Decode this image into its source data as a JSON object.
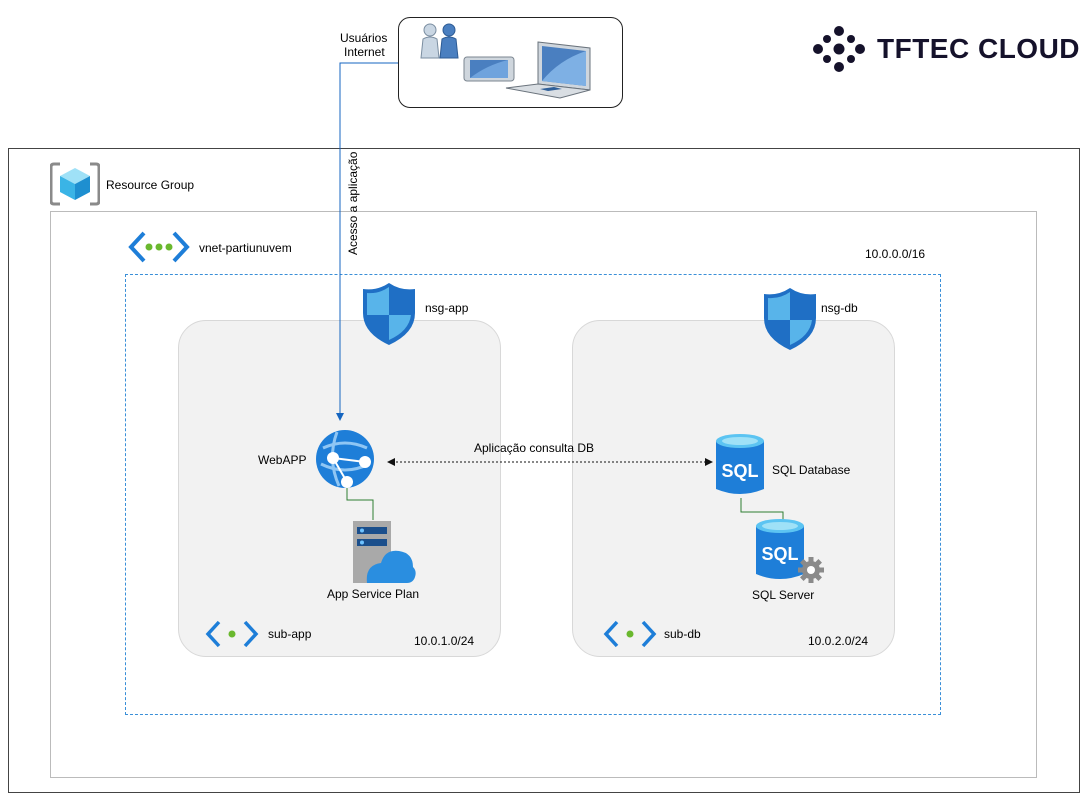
{
  "brand": {
    "name": "TFTEC CLOUD"
  },
  "users": {
    "label_line1": "Usuários",
    "label_line2": "Internet"
  },
  "connection_user": {
    "label": "Acesso a aplicação"
  },
  "resource_group": {
    "label": "Resource Group"
  },
  "vnet": {
    "label": "vnet-partiunuvem",
    "cidr": "10.0.0.0/16"
  },
  "subnets": [
    {
      "name": "sub-app",
      "cidr": "10.0.1.0/24",
      "nsg": "nsg-app"
    },
    {
      "name": "sub-db",
      "cidr": "10.0.2.0/24",
      "nsg": "nsg-db"
    }
  ],
  "resources": {
    "webapp": "WebAPP",
    "app_service_plan": "App Service Plan",
    "sql_database": "SQL Database",
    "sql_server": "SQL Server"
  },
  "connection_app_db": {
    "label": "Aplicação consulta DB"
  },
  "colors": {
    "azure_blue": "#1e7ed8",
    "dashed_vnet": "#3a8fd8",
    "subnet_fill": "#f2f2f2",
    "connector_green": "#2e7d32",
    "brand_dark": "#15122b"
  }
}
